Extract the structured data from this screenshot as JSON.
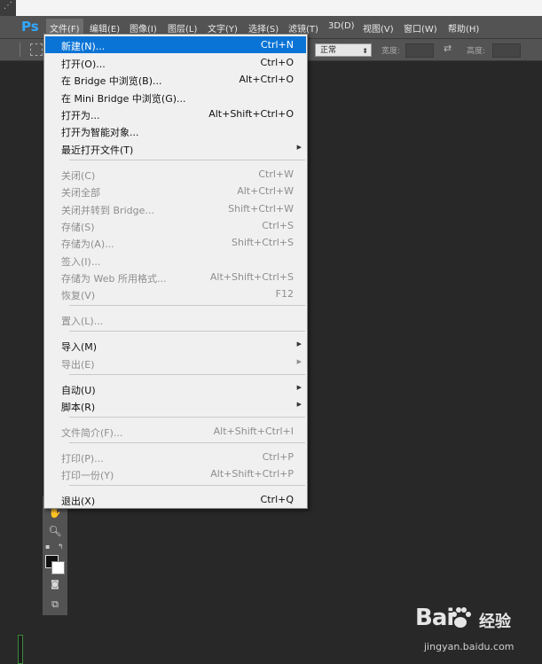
{
  "menubar": {
    "logo": "Ps",
    "items": [
      "文件(F)",
      "编辑(E)",
      "图像(I)",
      "图层(L)",
      "文字(Y)",
      "选择(S)",
      "滤镜(T)",
      "3D(D)",
      "视图(V)",
      "窗口(W)",
      "帮助(H)"
    ]
  },
  "options": {
    "style_value": "正常",
    "width_label": "宽度:",
    "height_label": "高度:"
  },
  "dropdown": {
    "items": [
      {
        "label": "新建(N)...",
        "shortcut": "Ctrl+N"
      },
      {
        "label": "打开(O)...",
        "shortcut": "Ctrl+O"
      },
      {
        "label": "在 Bridge 中浏览(B)...",
        "shortcut": "Alt+Ctrl+O"
      },
      {
        "label": "在 Mini Bridge 中浏览(G)...",
        "shortcut": ""
      },
      {
        "label": "打开为...",
        "shortcut": "Alt+Shift+Ctrl+O"
      },
      {
        "label": "打开为智能对象...",
        "shortcut": ""
      },
      {
        "label": "最近打开文件(T)",
        "shortcut": ""
      },
      {
        "label": "关闭(C)",
        "shortcut": "Ctrl+W"
      },
      {
        "label": "关闭全部",
        "shortcut": "Alt+Ctrl+W"
      },
      {
        "label": "关闭并转到 Bridge...",
        "shortcut": "Shift+Ctrl+W"
      },
      {
        "label": "存储(S)",
        "shortcut": "Ctrl+S"
      },
      {
        "label": "存储为(A)...",
        "shortcut": "Shift+Ctrl+S"
      },
      {
        "label": "签入(I)...",
        "shortcut": ""
      },
      {
        "label": "存储为 Web 所用格式...",
        "shortcut": "Alt+Shift+Ctrl+S"
      },
      {
        "label": "恢复(V)",
        "shortcut": "F12"
      },
      {
        "label": "置入(L)...",
        "shortcut": ""
      },
      {
        "label": "导入(M)",
        "shortcut": ""
      },
      {
        "label": "导出(E)",
        "shortcut": ""
      },
      {
        "label": "自动(U)",
        "shortcut": ""
      },
      {
        "label": "脚本(R)",
        "shortcut": ""
      },
      {
        "label": "文件简介(F)...",
        "shortcut": "Alt+Shift+Ctrl+I"
      },
      {
        "label": "打印(P)...",
        "shortcut": "Ctrl+P"
      },
      {
        "label": "打印一份(Y)",
        "shortcut": "Alt+Shift+Ctrl+P"
      },
      {
        "label": "退出(X)",
        "shortcut": "Ctrl+Q"
      }
    ]
  },
  "watermark": {
    "logo_a": "Bai",
    "logo_b": "经验",
    "url": "jingyan.baidu.com"
  },
  "colors": {
    "highlight": "#0a74d6",
    "workspace": "#282828",
    "menubar": "#535353"
  }
}
